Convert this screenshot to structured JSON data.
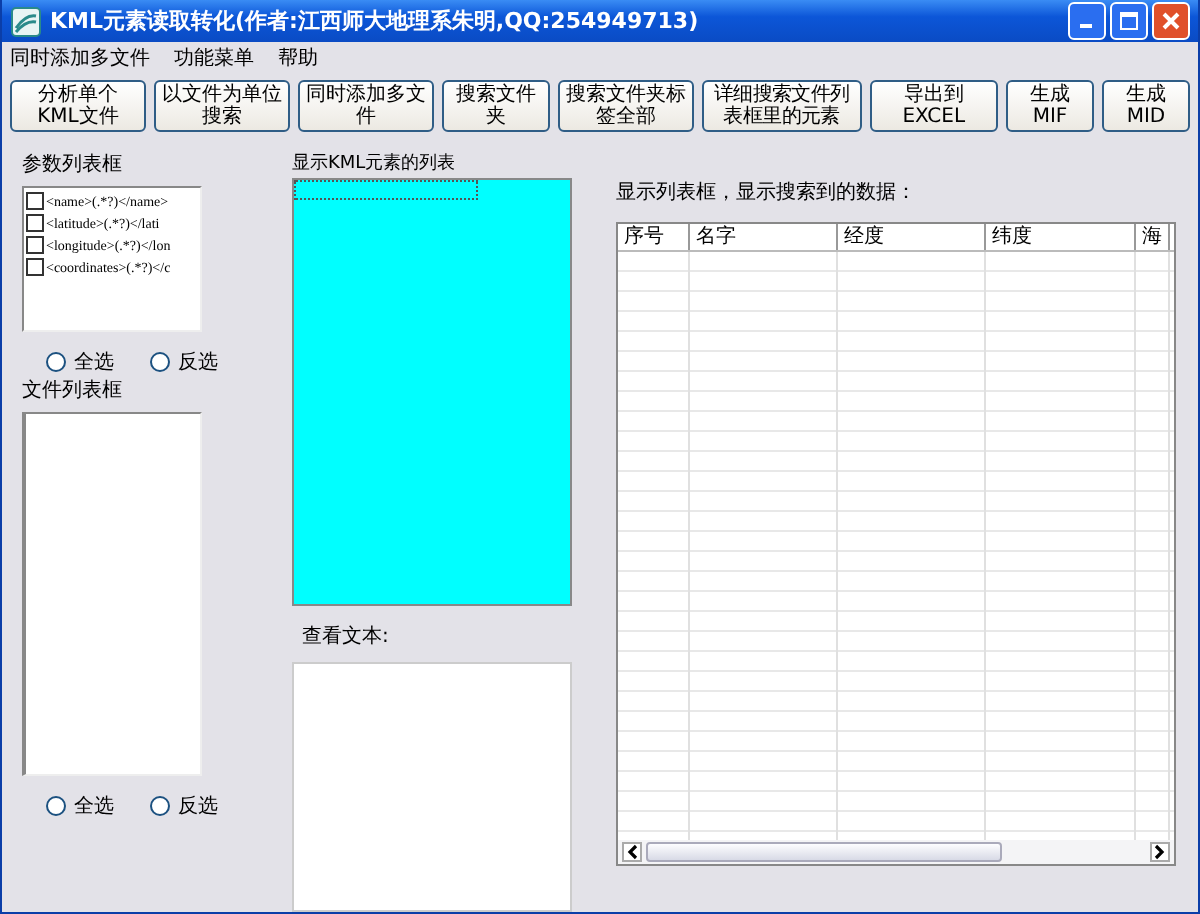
{
  "window": {
    "title": "KML元素读取转化(作者:江西师大地理系朱明,QQ:254949713)"
  },
  "menu": [
    "同时添加多文件",
    "功能菜单",
    "帮助"
  ],
  "toolbar": [
    "分析单个KML文件",
    "以文件为单位搜索",
    "同时添加多文件",
    "搜索文件夹",
    "搜索文件夹标签全部",
    "详细搜索文件列表框里的元素",
    "导出到EXCEL",
    "生成MIF",
    "生成MID"
  ],
  "params": {
    "label": "参数列表框",
    "items": [
      {
        "text": "<name>(.*?)</name>",
        "checked": false
      },
      {
        "text": "<latitude>(.*?)</lati",
        "checked": false
      },
      {
        "text": "<longitude>(.*?)</lon",
        "checked": false
      },
      {
        "text": "<coordinates>(.*?)</c",
        "checked": false
      }
    ],
    "radios": [
      {
        "label": "全选",
        "selected": false
      },
      {
        "label": "反选",
        "selected": false
      }
    ]
  },
  "files": {
    "label": "文件列表框",
    "radios": [
      {
        "label": "全选",
        "selected": false
      },
      {
        "label": "反选",
        "selected": false
      }
    ]
  },
  "element_list": {
    "label": "显示KML元素的列表"
  },
  "view_text": {
    "label": "查看文本:"
  },
  "results": {
    "label": "显示列表框，显示搜索到的数据：",
    "columns": [
      "序号",
      "名字",
      "经度",
      "纬度",
      "海"
    ]
  }
}
